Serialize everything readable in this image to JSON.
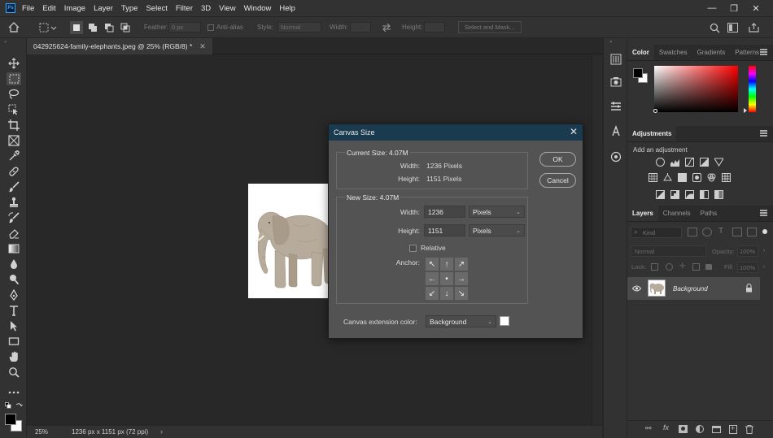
{
  "app": {
    "logo": "Ps"
  },
  "menu": [
    "File",
    "Edit",
    "Image",
    "Layer",
    "Type",
    "Select",
    "Filter",
    "3D",
    "View",
    "Window",
    "Help"
  ],
  "window_controls": {
    "minimize": "—",
    "restore": "❐",
    "close": "✕"
  },
  "options_bar": {
    "feather_label": "Feather:",
    "feather_value": "0 px",
    "antialias_label": "Anti-alias",
    "style_label": "Style:",
    "style_value": "Normal",
    "width_label": "Width:",
    "height_label": "Height:",
    "select_mask_button": "Select and Mask..."
  },
  "document": {
    "tab_title": "042925624-family-elephants.jpeg @ 25% (RGB/8) *",
    "zoom": "25%",
    "status_info": "1236 px x 1151 px (72 ppi)"
  },
  "panels": {
    "color_tabs": [
      "Color",
      "Swatches",
      "Gradients",
      "Patterns"
    ],
    "adjustments_tab": "Adjustments",
    "add_adjustment": "Add an adjustment",
    "layers_tabs": [
      "Layers",
      "Channels",
      "Paths"
    ],
    "kind_placeholder": "Kind",
    "blend_mode": "Normal",
    "opacity_label": "Opacity:",
    "opacity_value": "100%",
    "lock_label": "Lock:",
    "fill_label": "Fill:",
    "fill_value": "100%",
    "layer_name": "Background"
  },
  "dialog": {
    "title": "Canvas Size",
    "current_size_label": "Current Size: 4.07M",
    "current_width_label": "Width:",
    "current_width_value": "1236 Pixels",
    "current_height_label": "Height:",
    "current_height_value": "1151 Pixels",
    "new_size_label": "New Size: 4.07M",
    "width_label": "Width:",
    "width_value": "1236",
    "width_unit": "Pixels",
    "height_label": "Height:",
    "height_value": "1151",
    "height_unit": "Pixels",
    "relative_label": "Relative",
    "relative_checked": false,
    "anchor_label": "Anchor:",
    "anchor_arrows": [
      "↖",
      "↑",
      "↗",
      "←",
      "•",
      "→",
      "↙",
      "↓",
      "↘"
    ],
    "extension_color_label": "Canvas extension color:",
    "extension_color_value": "Background",
    "extension_swatch_color": "#ffffff",
    "ok_button": "OK",
    "cancel_button": "Cancel"
  },
  "colors": {
    "foreground": "#000000",
    "background": "#ffffff",
    "dialog_title_bg": "#1a3a4f"
  }
}
